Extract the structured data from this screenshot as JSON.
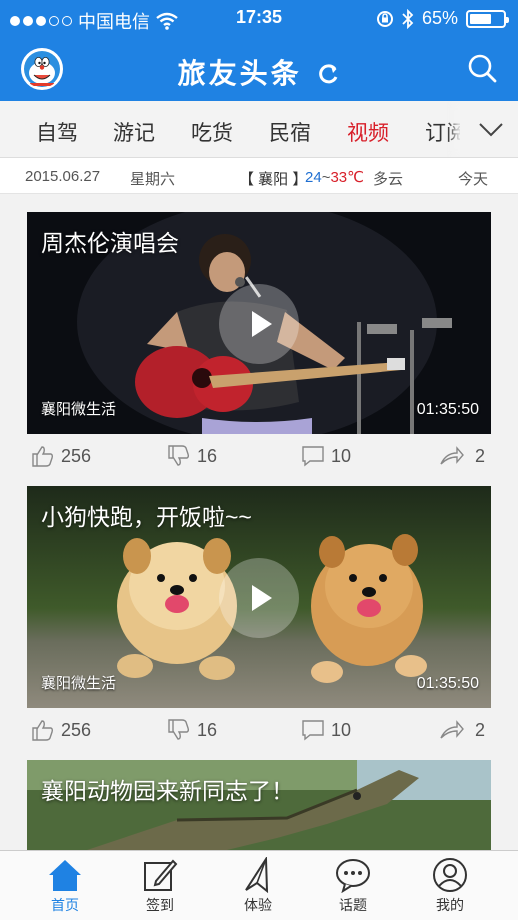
{
  "status_bar": {
    "carrier": "中国电信",
    "time": "17:35",
    "battery": "65%",
    "battery_level": 0.65
  },
  "header": {
    "title": "旅友头条"
  },
  "categories": {
    "items": [
      {
        "label": "自驾"
      },
      {
        "label": "游记"
      },
      {
        "label": "吃货"
      },
      {
        "label": "民宿"
      },
      {
        "label": "视频"
      },
      {
        "label": "订阅"
      }
    ],
    "active": "视频"
  },
  "datebar": {
    "date": "2015.06.27",
    "weekday": "星期六",
    "city": "【 襄阳 】",
    "temp_low": "24",
    "temp_sep": "~",
    "temp_high": "33℃",
    "weather": "多云",
    "today": "今天"
  },
  "feed": [
    {
      "title": "周杰伦演唱会",
      "source": "襄阳微生活",
      "duration": "01:35:50",
      "likes": "256",
      "dislikes": "16",
      "comments": "10",
      "shares": "2"
    },
    {
      "title": "小狗快跑，开饭啦~~",
      "source": "襄阳微生活",
      "duration": "01:35:50",
      "likes": "256",
      "dislikes": "16",
      "comments": "10",
      "shares": "2"
    },
    {
      "title": "襄阳动物园来新同志了！"
    }
  ],
  "bottom_nav": [
    {
      "label": "首页",
      "icon": "home-icon"
    },
    {
      "label": "签到",
      "icon": "checkin-icon"
    },
    {
      "label": "体验",
      "icon": "paper-plane-icon"
    },
    {
      "label": "话题",
      "icon": "chat-bubble-icon"
    },
    {
      "label": "我的",
      "icon": "user-icon"
    }
  ],
  "colors": {
    "brand_blue": "#1f82e3",
    "active_red": "#d8202a"
  }
}
